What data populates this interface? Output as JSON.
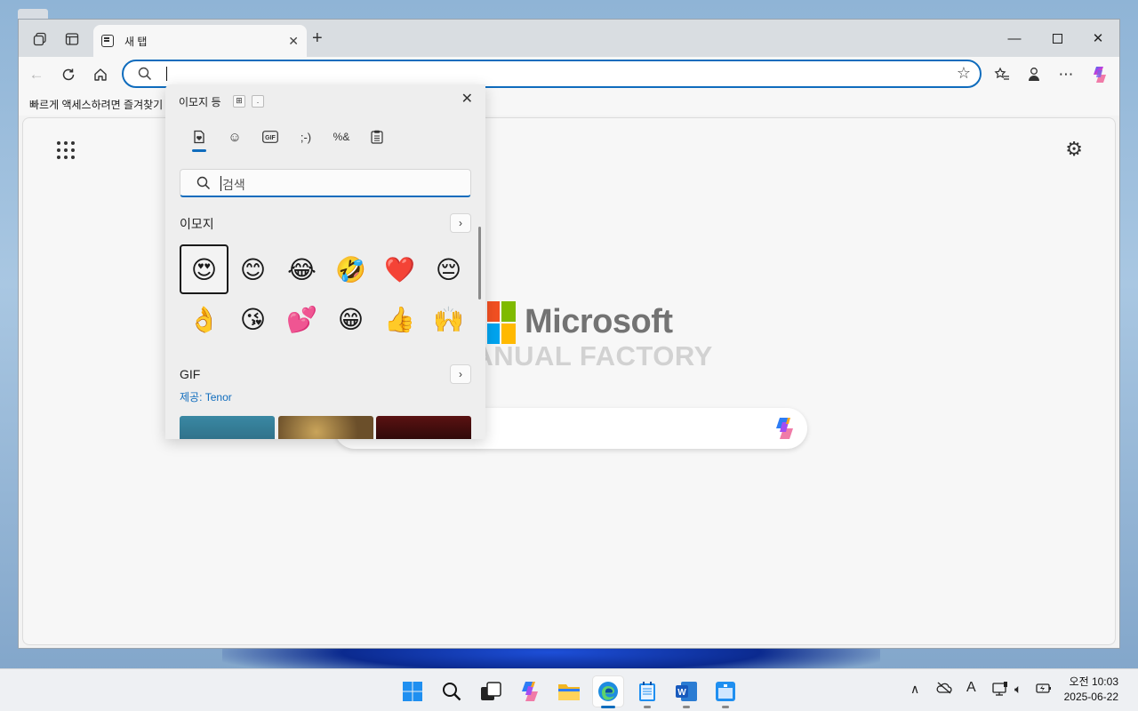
{
  "browser": {
    "tab_title": "새 탭",
    "favorites_bar_text": "빠르게 액세스하려면 즐겨찾기",
    "address_value": ""
  },
  "newtab_page": {
    "brand_word": "Microsoft",
    "watermark": "MANUAL FACTORY",
    "logo_colors": [
      "#f25022",
      "#7fba00",
      "#00a4ef",
      "#ffb900"
    ]
  },
  "emoji_panel": {
    "title": "이모지 등",
    "key_hint_1": "⊞",
    "key_hint_2": ".",
    "tabs": [
      "favorites-icon",
      "smiley-icon",
      "gif-icon",
      "kaomoji-icon",
      "symbols-icon",
      "clipboard-icon"
    ],
    "kaomoji_label": ";-)",
    "gif_tab_label": "GIF",
    "search_placeholder": "검색",
    "emoji_section_title": "이모지",
    "emojis": [
      "😍",
      "😊",
      "😂",
      "🤣",
      "❤️",
      "😔",
      "👌",
      "😘",
      "💕",
      "😁",
      "👍",
      "🙌"
    ],
    "gif_section_title": "GIF",
    "gif_credit": "제공: Tenor"
  },
  "taskbar": {
    "clock_time": "오전 10:03",
    "clock_date": "2025-06-22",
    "ime_indicator": "A"
  },
  "colors": {
    "accent": "#0f6cbd"
  }
}
